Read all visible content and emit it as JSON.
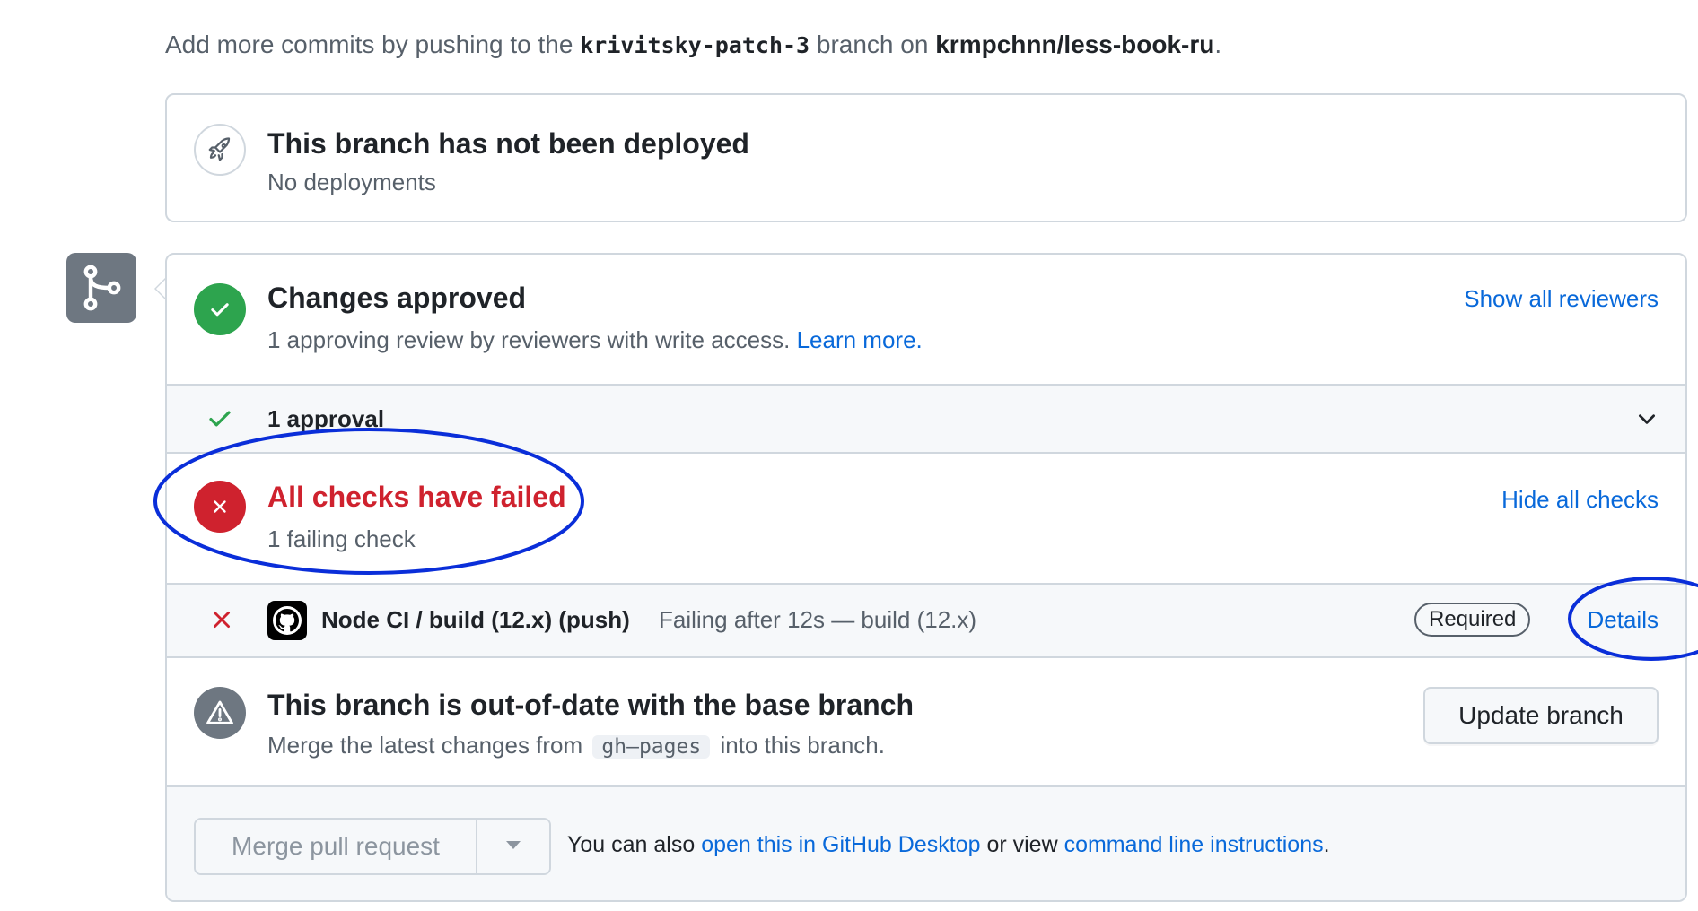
{
  "hint": {
    "prefix": "Add more commits by pushing to the",
    "branch": "krivitsky-patch-3",
    "middle": "branch on",
    "repo": "krmpchnn/less-book-ru",
    "suffix": "."
  },
  "deployment": {
    "title": "This branch has not been deployed",
    "subtitle": "No deployments"
  },
  "approval": {
    "title": "Changes approved",
    "subtitle": "1 approving review by reviewers with write access.",
    "learn_more": "Learn more.",
    "show_reviewers": "Show all reviewers",
    "approval_count": "1 approval"
  },
  "checks": {
    "title": "All checks have failed",
    "subtitle": "1 failing check",
    "hide_checks": "Hide all checks",
    "items": [
      {
        "name": "Node CI / build (12.x) (push)",
        "description": "Failing after 12s — build (12.x)",
        "badge": "Required",
        "details": "Details"
      }
    ]
  },
  "outdated": {
    "title": "This branch is out-of-date with the base branch",
    "subtitle_prefix": "Merge the latest changes from",
    "base_branch": "gh–pages",
    "subtitle_suffix": "into this branch.",
    "update_button": "Update branch"
  },
  "merge": {
    "button": "Merge pull request",
    "note_prefix": "You can also",
    "desktop_link": "open this in GitHub Desktop",
    "note_middle": "or view",
    "cli_link": "command line instructions",
    "note_suffix": "."
  },
  "colors": {
    "success": "#2da44e",
    "danger": "#cf222e",
    "link": "#0969da",
    "annotation": "#0a2ed9",
    "neutral_icon": "#6e7781"
  }
}
